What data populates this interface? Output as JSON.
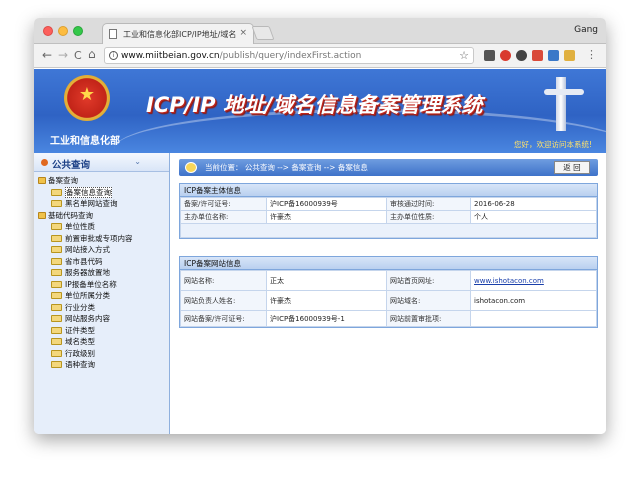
{
  "browser": {
    "tab_title": "工业和信息化部ICP/IP地址/域名",
    "tab_close": "×",
    "user_name": "Gang",
    "back": "←",
    "forward": "→",
    "reload": "C",
    "home": "⌂",
    "info_icon": "i",
    "url_host": "www.miitbeian.gov.cn",
    "url_path": "/publish/query/indexFirst.action",
    "star": "☆"
  },
  "banner": {
    "ministry": "工业和信息化部",
    "system_title": "ICP/IP 地址/域名信息备案管理系统",
    "welcome": "您好，欢迎访问本系统!"
  },
  "sidebar": {
    "header": "公共查询",
    "chevron": "⌄",
    "items": [
      {
        "label": "备案查询",
        "level": 0
      },
      {
        "label": "备案信息查询",
        "level": 1,
        "selected": true
      },
      {
        "label": "黑名单网站查询",
        "level": 1
      },
      {
        "label": "基础代码查询",
        "level": 0
      },
      {
        "label": "单位性质",
        "level": 1
      },
      {
        "label": "前置审批或专项内容",
        "level": 1
      },
      {
        "label": "网站接入方式",
        "level": 1
      },
      {
        "label": "省市县代码",
        "level": 1
      },
      {
        "label": "服务器放置地",
        "level": 1
      },
      {
        "label": "IP报备单位名称",
        "level": 1
      },
      {
        "label": "单位所属分类",
        "level": 1
      },
      {
        "label": "行业分类",
        "level": 1
      },
      {
        "label": "网站服务内容",
        "level": 1
      },
      {
        "label": "证件类型",
        "level": 1
      },
      {
        "label": "域名类型",
        "level": 1
      },
      {
        "label": "行政级别",
        "level": 1
      },
      {
        "label": "语种查询",
        "level": 1
      }
    ]
  },
  "main": {
    "breadcrumb": "当前位置： 公共查询  -->  备案查询  -->  备案信息",
    "back_button": "返  回",
    "subject_panel": {
      "title": "ICP备案主体信息",
      "rows": [
        {
          "k1": "备案/许可证号:",
          "v1": "沪ICP备16000939号",
          "k2": "审核通过时间:",
          "v2": "2016-06-28"
        },
        {
          "k1": "主办单位名称:",
          "v1": "许豪杰",
          "k2": "主办单位性质:",
          "v2": "个人"
        }
      ]
    },
    "site_panel": {
      "title": "ICP备案网站信息",
      "rows": [
        {
          "k1": "网站名称:",
          "v1": "正太",
          "k2": "网站首页网址:",
          "v2": "www.ishotacon.com"
        },
        {
          "k1": "网站负责人姓名:",
          "v1": "许豪杰",
          "k2": "网站域名:",
          "v2": "ishotacon.com"
        },
        {
          "k1": "网站备案/许可证号:",
          "v1": "沪ICP备16000939号-1",
          "k2": "网站前置审批项:",
          "v2": ""
        }
      ]
    }
  },
  "colors": {
    "banner": "#3f77d6",
    "title_shadow": "#c1241a",
    "welcome": "#ffe16a",
    "sidebar_bg": "#e6eefa",
    "panel_border": "#7ea6dc"
  }
}
